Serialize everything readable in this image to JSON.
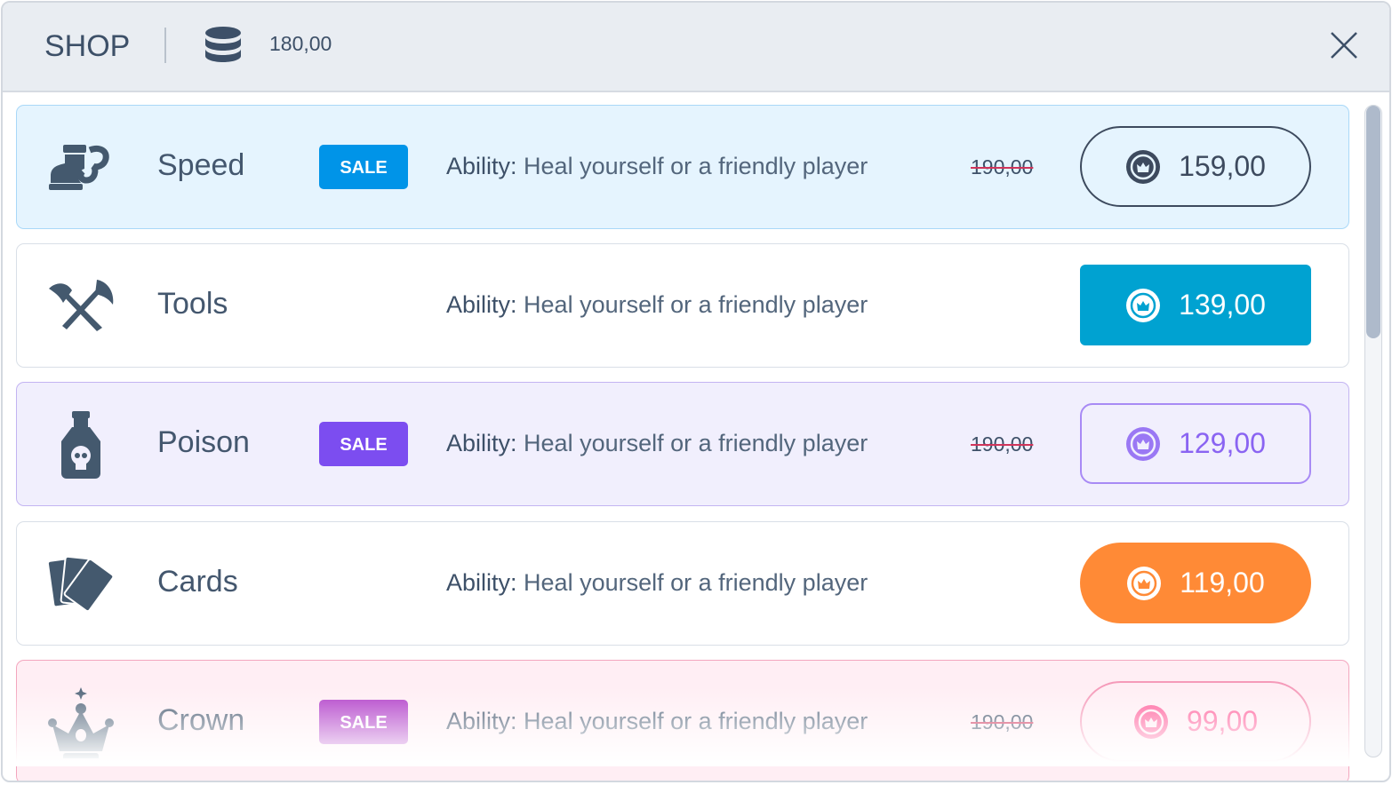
{
  "header": {
    "title": "SHOP",
    "balance": "180,00",
    "coin_icon": "coins-stack-icon",
    "close_icon": "close-icon"
  },
  "items": [
    {
      "name": "Speed",
      "sale": "SALE",
      "ability_label": "Ability:",
      "ability": "Heal yourself or a friendly player",
      "old_price": "190,00",
      "price": "159,00",
      "icon": "winged-boot-icon",
      "accent": "#0094e8"
    },
    {
      "name": "Tools",
      "ability_label": "Ability:",
      "ability": "Heal yourself or a friendly player",
      "price": "139,00",
      "icon": "crossed-axes-icon",
      "accent": "#00a2d1"
    },
    {
      "name": "Poison",
      "sale": "SALE",
      "ability_label": "Ability:",
      "ability": "Heal yourself or a friendly player",
      "old_price": "190,00",
      "price": "129,00",
      "icon": "poison-bottle-icon",
      "accent": "#7c4df0"
    },
    {
      "name": "Cards",
      "ability_label": "Ability:",
      "ability": "Heal yourself or a friendly player",
      "price": "119,00",
      "icon": "cards-icon",
      "accent": "#ff8a36"
    },
    {
      "name": "Crown",
      "sale": "SALE",
      "ability_label": "Ability:",
      "ability": "Heal yourself or a friendly player",
      "old_price": "190,00",
      "price": "99,00",
      "icon": "crown-icon",
      "accent": "#ff5f9b"
    }
  ]
}
